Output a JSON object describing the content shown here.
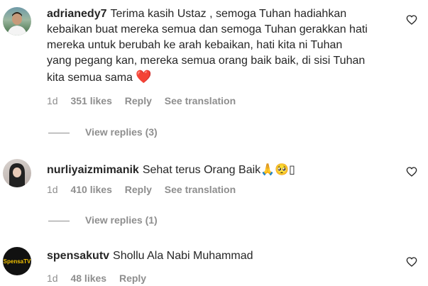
{
  "colors": {
    "text": "#262626",
    "secondary": "#8e8e8e",
    "heart": "#e0242e"
  },
  "comments": [
    {
      "username": "adrianedy7",
      "text_lines": [
        "Terima kasih Ustaz , semoga Tuhan hadiahkan",
        "kebaikan buat mereka semua dan semoga Tuhan gerakkan hati",
        "mereka untuk berubah ke arah kebaikan, hati kita ni Tuhan",
        "yang pegang kan, mereka semua orang baik baik, di sisi Tuhan",
        "kita semua sama"
      ],
      "trailing_emoji": "❤️",
      "time": "1d",
      "likes": "351 likes",
      "reply": "Reply",
      "translate": "See translation",
      "view_replies": "View replies (3)",
      "like_icon": "heart-outline-icon"
    },
    {
      "username": "nurliyaizmimanik",
      "text": "Sehat terus Orang Baik",
      "trailing_emoji": "🙏🥺▯",
      "time": "1d",
      "likes": "410 likes",
      "reply": "Reply",
      "translate": "See translation",
      "view_replies": "View replies (1)",
      "like_icon": "heart-outline-icon"
    },
    {
      "username": "spensakutv",
      "text": "Shollu Ala Nabi Muhammad",
      "avatar_text": "SpensaTV",
      "time": "1d",
      "likes": "48 likes",
      "reply": "Reply",
      "like_icon": "heart-outline-icon"
    }
  ]
}
